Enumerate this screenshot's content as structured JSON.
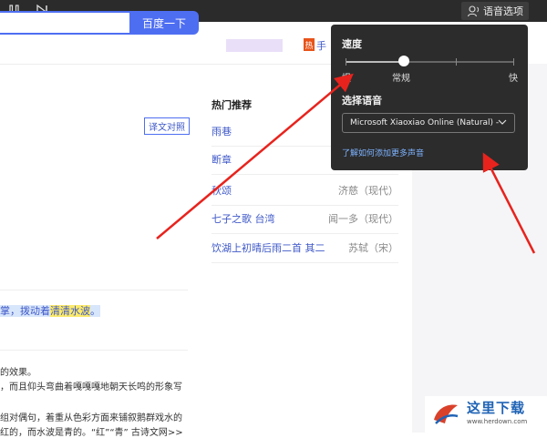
{
  "topbar": {
    "voice_options_label": "语音选项",
    "pause_icon": "pause-icon",
    "next_icon": "skip-next-icon"
  },
  "search": {
    "button_label": "百度一下",
    "hand_link": "手"
  },
  "page": {
    "compare_button": "译文对照",
    "hot": {
      "title": "热门推荐",
      "items": [
        {
          "title": "雨巷",
          "author": ""
        },
        {
          "title": "断章",
          "author": ""
        },
        {
          "title": "秋颂",
          "author": "济慈（现代）"
        },
        {
          "title": "七子之歌 台湾",
          "author": "闻一多（现代）"
        },
        {
          "title": "饮湖上初晴后雨二首 其二",
          "author": "苏轼（宋）"
        }
      ]
    },
    "highlight": {
      "a": "掌，拨动着",
      "b": "清清",
      "c": "水波",
      "d": "。"
    },
    "lines": [
      "的效果。",
      "，而且仰头弯曲着嘎嘎嘎地朝天长鸣的形象写",
      "组对偶句，着重从色彩方面来铺叙鹅群戏水的",
      "红的，而水波是青的。“红”“青”  古诗文网>>"
    ]
  },
  "popup": {
    "speed_label": "速度",
    "speed_slow": "慢",
    "speed_normal": "常规",
    "speed_fast": "快",
    "speed_value": 0.35,
    "language_label": "选择语音",
    "selected_voice": "Microsoft Xiaoxiao Online (Natural) -",
    "add_voices_link": "了解如何添加更多声音"
  },
  "watermark": {
    "title": "这里下载",
    "url": "www.herdown.com"
  },
  "colors": {
    "accent": "#4e6ef2",
    "arrow": "#e8231d",
    "popup_bg": "#2c2c2c"
  }
}
